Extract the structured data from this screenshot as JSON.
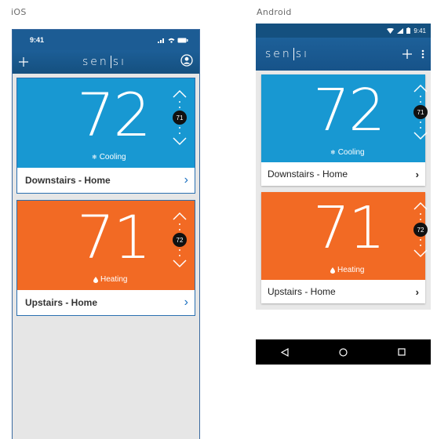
{
  "labels": {
    "ios": "iOS",
    "android": "Android"
  },
  "ios": {
    "time": "9:41",
    "app_logo_left": "sen",
    "app_logo_right": "sı",
    "cards": [
      {
        "temp": "72",
        "mode": "Cooling",
        "setpoint": "71",
        "name": "Downstairs - Home"
      },
      {
        "temp": "71",
        "mode": "Heating",
        "setpoint": "72",
        "name": "Upstairs - Home"
      }
    ]
  },
  "android": {
    "time": "9:41",
    "app_logo_left": "sen",
    "app_logo_right": "sı",
    "cards": [
      {
        "temp": "72",
        "mode": "Cooling",
        "setpoint": "71",
        "name": "Downstairs - Home"
      },
      {
        "temp": "71",
        "mode": "Heating",
        "setpoint": "72",
        "name": "Upstairs - Home"
      }
    ]
  },
  "colors": {
    "cooling": "#1898d2",
    "heating": "#f26a24",
    "header": "#1c5c94"
  },
  "icons": [
    "plus-icon",
    "profile-icon",
    "overflow-menu-icon",
    "chevron-up-icon",
    "chevron-down-icon",
    "snowflake-icon",
    "flame-icon",
    "back-icon",
    "home-icon",
    "recents-icon"
  ]
}
